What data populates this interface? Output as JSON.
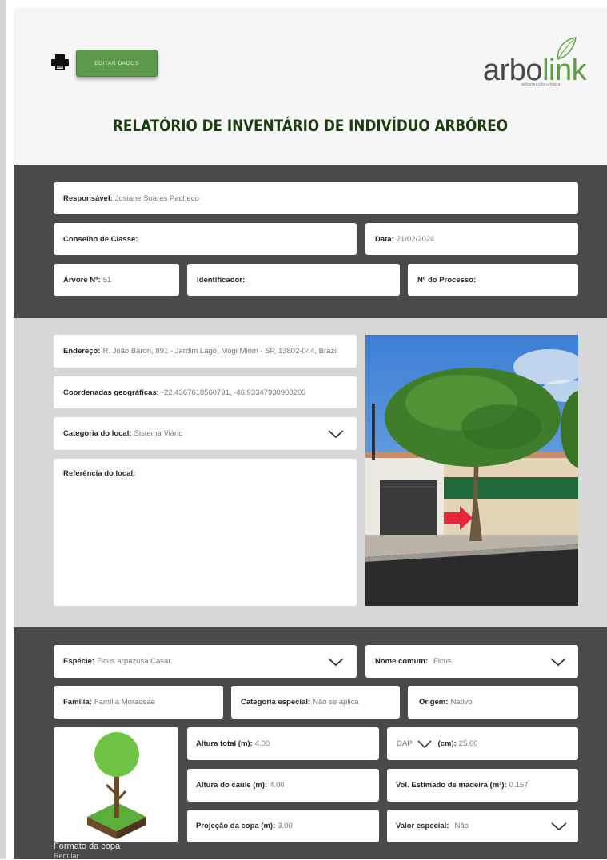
{
  "header": {
    "edit_button": "EDITAR DADOS",
    "title": "RELATÓRIO DE INVENTÁRIO DE INDIVÍDUO ARBÓREO",
    "logo": {
      "text_prefix": "arbo",
      "text_suffix": "link",
      "tagline": "arborização urbana"
    }
  },
  "general": {
    "responsavel": {
      "label": "Responsável:",
      "value": "Josiane Soares Pacheco"
    },
    "conselho": {
      "label": "Conselho de Classe:",
      "value": ""
    },
    "data": {
      "label": "Data:",
      "value": "21/02/2024"
    },
    "arvore": {
      "label": "Árvore Nº:",
      "value": "51"
    },
    "identificador": {
      "label": "Identificador:",
      "value": ""
    },
    "processo": {
      "label": "Nº do Processo:",
      "value": ""
    }
  },
  "location": {
    "endereco": {
      "label": "Endereço:",
      "value": "R. João Baron, 891 - Jardim Lago, Mogi Mirim - SP, 13802-044, Brazil"
    },
    "coordenadas": {
      "label": "Coordenadas geográficas:",
      "value": "-22.4367618560791, -46.93347930908203"
    },
    "categoria": {
      "label": "Categoria do local:",
      "value": "Sistema Viário"
    },
    "referencia": {
      "label": "Referência do local:",
      "value": ""
    }
  },
  "tree": {
    "especie": {
      "label": "Espécie:",
      "value": "Ficus arpazusa Casar."
    },
    "nome_comum": {
      "label": "Nome comum:",
      "value": "Ficus"
    },
    "familia": {
      "label": "Família:",
      "value": "Família Moraceae"
    },
    "categoria_especial": {
      "label": "Categoria especial:",
      "value": "Não se aplica"
    },
    "origem": {
      "label": "Origem:",
      "value": "Nativo"
    },
    "altura_total": {
      "label": "Altura total (m):",
      "value": "4.00"
    },
    "dap": {
      "label_prefix": "DAP",
      "label": "(cm):",
      "value": "25.00"
    },
    "altura_caule": {
      "label": "Altura do caule (m):",
      "value": "4.00"
    },
    "vol_madeira": {
      "label": "Vol. Estimado de madeira (m³):",
      "value": "0.157"
    },
    "projecao_copa": {
      "label": "Projeção da copa (m):",
      "value": "3.00"
    },
    "valor_especial": {
      "label": "Valor especial:",
      "value": "Não"
    },
    "formato_copa": {
      "label": "Formato da copa",
      "value": "Regular"
    }
  },
  "icons": [
    "print-icon",
    "chevron-down-icon",
    "tree-icon",
    "leaf-icon"
  ],
  "colors": {
    "accent_green": "#5c9a4a",
    "title_green": "#1a3c0f",
    "dark_band": "#4a4a4a",
    "light_band": "#d7d7d7",
    "header_bg": "#f6f6f6"
  }
}
